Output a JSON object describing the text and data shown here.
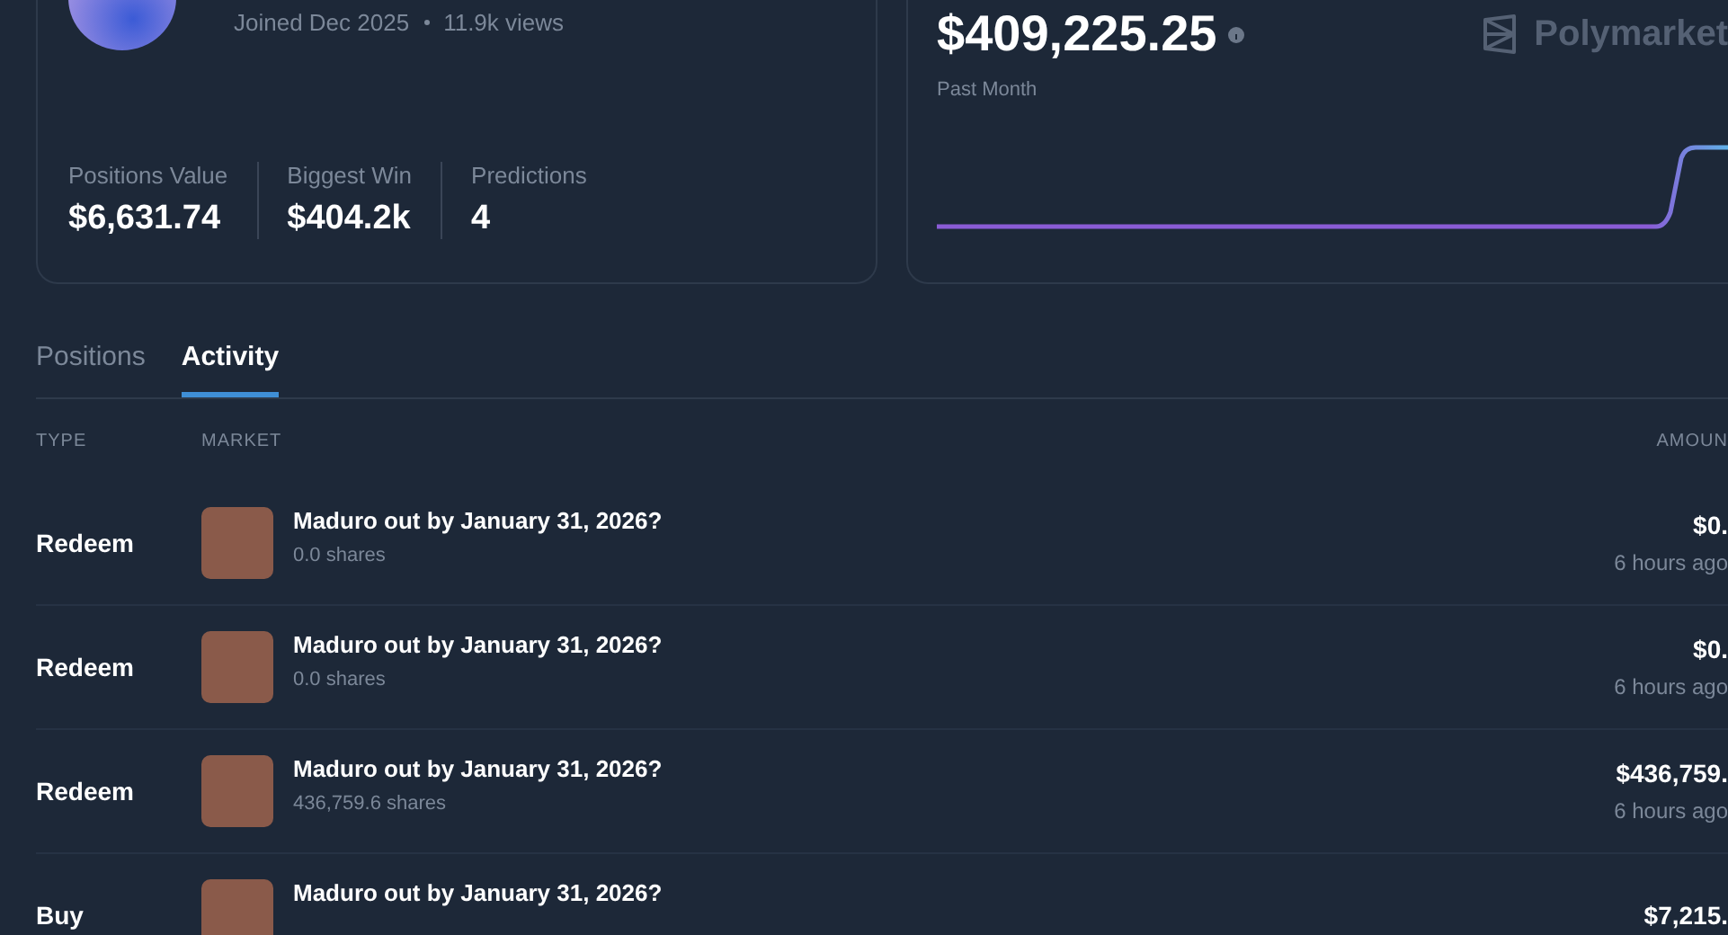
{
  "profile": {
    "joined": "Joined Dec 2025",
    "views": "11.9k views",
    "stats": [
      {
        "label": "Positions Value",
        "value": "$6,631.74"
      },
      {
        "label": "Biggest Win",
        "value": "$404.2k"
      },
      {
        "label": "Predictions",
        "value": "4"
      }
    ]
  },
  "pnl": {
    "value": "$409,225.25",
    "period": "Past Month",
    "brand": "Polymarket"
  },
  "tabs": [
    {
      "label": "Positions",
      "selected": false
    },
    {
      "label": "Activity",
      "selected": true
    }
  ],
  "table": {
    "columns": [
      "TYPE",
      "MARKET",
      "AMOUN"
    ],
    "rows": [
      {
        "type": "Redeem",
        "market": "Maduro out by January 31, 2026?",
        "shares": "0.0 shares",
        "amount": "$0.",
        "time": "6 hours ago"
      },
      {
        "type": "Redeem",
        "market": "Maduro out by January 31, 2026?",
        "shares": "0.0 shares",
        "amount": "$0.",
        "time": "6 hours ago"
      },
      {
        "type": "Redeem",
        "market": "Maduro out by January 31, 2026?",
        "shares": "436,759.6 shares",
        "amount": "$436,759.",
        "time": "6 hours ago"
      },
      {
        "type": "Buy",
        "market": "Maduro out by January 31, 2026?",
        "amount": "$7,215."
      }
    ]
  }
}
